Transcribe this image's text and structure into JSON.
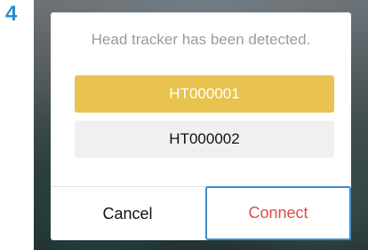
{
  "step": {
    "number": "4"
  },
  "dialog": {
    "message": "Head tracker has been detected.",
    "trackers": [
      {
        "label": "HT000001",
        "selected": true
      },
      {
        "label": "HT000002",
        "selected": false
      }
    ],
    "buttons": {
      "cancel_label": "Cancel",
      "connect_label": "Connect"
    }
  },
  "colors": {
    "step_number": "#2a8fcf",
    "selected_item_bg": "#e8c34f",
    "unselected_item_bg": "#f0f0f0",
    "connect_text": "#e04b4b",
    "focus_outline": "#3d8ccf",
    "message_text": "#9a9a9a"
  }
}
